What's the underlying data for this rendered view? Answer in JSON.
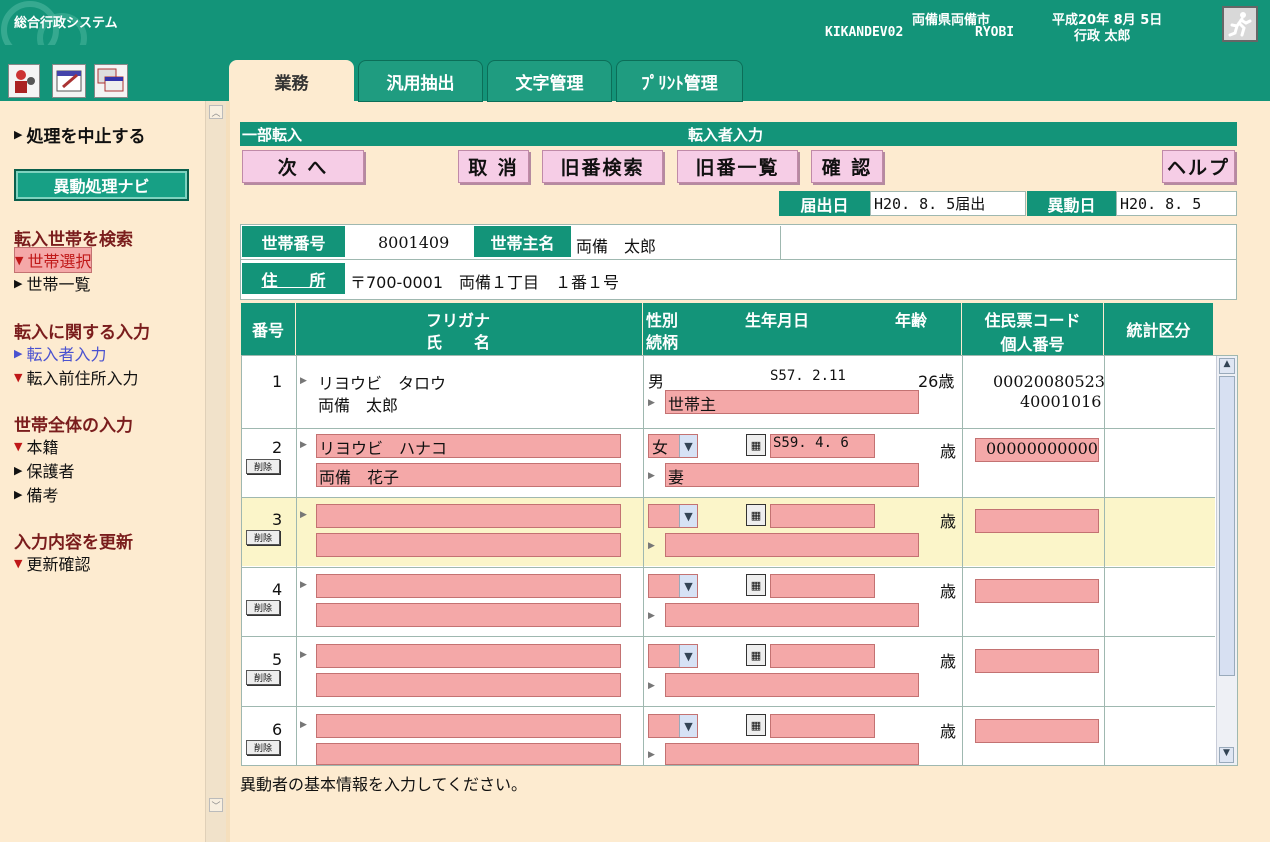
{
  "app": {
    "title": "総合行政システム",
    "org": "両備県両備市",
    "date": "平成20年 8月 5日",
    "terminal": "KIKANDEV02",
    "server": "RYOBI",
    "user": "行政 太郎"
  },
  "tabs": [
    "業務",
    "汎用抽出",
    "文字管理",
    "ﾌﾟﾘﾝﾄ管理"
  ],
  "sidebar": {
    "cancel": "処理を中止する",
    "navi_button": "異動処理ナビ",
    "sections": [
      {
        "title": "転入世帯を検索",
        "items": [
          {
            "label": "世帯選択",
            "marker": "▼"
          },
          {
            "label": "世帯一覧",
            "marker": "▶"
          }
        ]
      },
      {
        "title": "転入に関する入力",
        "items": [
          {
            "label": "転入者入力",
            "marker": "▶"
          },
          {
            "label": "転入前住所入力",
            "marker": "▼"
          }
        ]
      },
      {
        "title": "世帯全体の入力",
        "items": [
          {
            "label": "本籍",
            "marker": "▼"
          },
          {
            "label": "保護者",
            "marker": "▶"
          },
          {
            "label": "備考",
            "marker": "▶"
          }
        ]
      },
      {
        "title": "入力内容を更新",
        "items": [
          {
            "label": "更新確認",
            "marker": "▼"
          }
        ]
      }
    ]
  },
  "main": {
    "mode": "一部転入",
    "screen_title": "転入者入力",
    "buttons": {
      "next": "次 へ",
      "cancel": "取 消",
      "old_search": "旧番検索",
      "old_list": "旧番一覧",
      "confirm": "確 認",
      "help": "ヘルプ"
    },
    "notify_label": "届出日",
    "notify_value": "H20. 8. 5届出",
    "change_label": "異動日",
    "change_value": "H20. 8. 5",
    "household_no_label": "世帯番号",
    "household_no": "8001409",
    "head_name_label": "世帯主名",
    "head_name": "両備　太郎",
    "address_label": "住　　所",
    "address": "〒700-0001　両備１丁目　１番１号",
    "table": {
      "h_no": "番号",
      "h_kana": "フリガナ",
      "h_name": "氏　　名",
      "h_sex": "性別",
      "h_rel": "続柄",
      "h_birth": "生年月日",
      "h_age": "年齢",
      "h_code": "住民票コード",
      "h_pid": "個人番号",
      "h_stat": "統計区分",
      "rows": [
        {
          "no": "1",
          "kana": "リヨウビ　タロウ",
          "name": "両備　太郎",
          "sex": "男",
          "birth": "S57. 2.11",
          "age": "26歳",
          "rel": "世帯主",
          "code": "00020080523",
          "pid": "40001016"
        },
        {
          "no": "2",
          "kana": "リヨウビ　ハナコ",
          "name": "両備　花子",
          "sex": "女",
          "birth": "S59. 4. 6",
          "age": "歳",
          "rel": "妻",
          "code": "00000000000",
          "pid": "",
          "delete": "削除"
        },
        {
          "no": "3",
          "kana": "",
          "name": "",
          "sex": "",
          "birth": "",
          "age": "歳",
          "rel": "",
          "code": "",
          "pid": "",
          "delete": "削除"
        },
        {
          "no": "4",
          "kana": "",
          "name": "",
          "sex": "",
          "birth": "",
          "age": "歳",
          "rel": "",
          "code": "",
          "pid": "",
          "delete": "削除"
        },
        {
          "no": "5",
          "kana": "",
          "name": "",
          "sex": "",
          "birth": "",
          "age": "歳",
          "rel": "",
          "code": "",
          "pid": "",
          "delete": "削除"
        },
        {
          "no": "6",
          "kana": "",
          "name": "",
          "sex": "",
          "birth": "",
          "age": "歳",
          "rel": "",
          "code": "",
          "pid": "",
          "delete": "削除"
        }
      ]
    },
    "status": "異動者の基本情報を入力してください。"
  }
}
